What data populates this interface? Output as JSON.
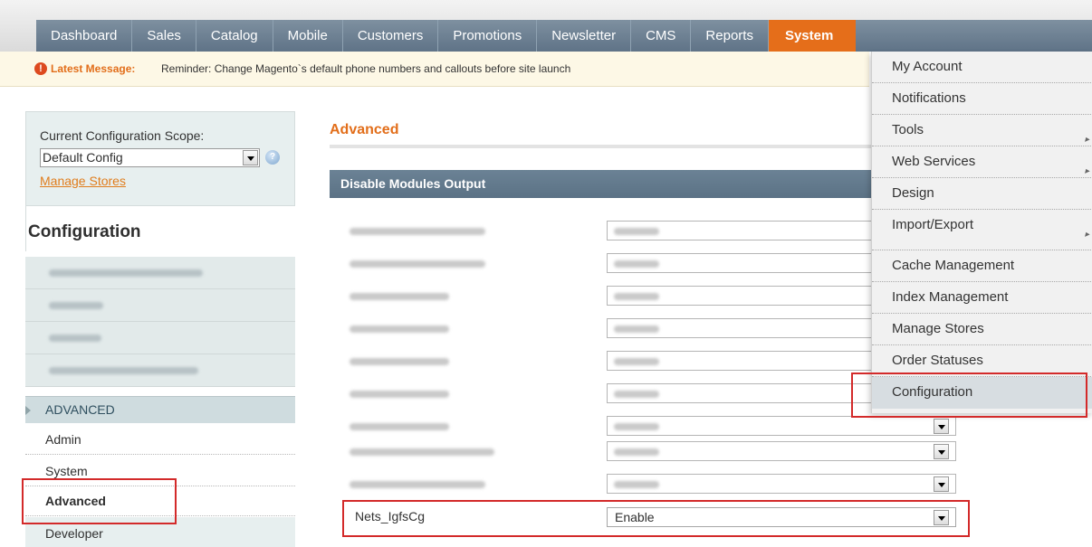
{
  "nav": {
    "items": [
      {
        "label": "Dashboard"
      },
      {
        "label": "Sales"
      },
      {
        "label": "Catalog"
      },
      {
        "label": "Mobile"
      },
      {
        "label": "Customers"
      },
      {
        "label": "Promotions"
      },
      {
        "label": "Newsletter"
      },
      {
        "label": "CMS"
      },
      {
        "label": "Reports"
      },
      {
        "label": "System"
      }
    ],
    "active": "System",
    "active_color": "#e56e1a"
  },
  "message": {
    "icon": "alert-icon",
    "label": "Latest Message:",
    "text": "Reminder: Change Magento`s default phone numbers and callouts before site launch"
  },
  "scope": {
    "label": "Current Configuration Scope:",
    "selected": "Default Config",
    "manage_link": "Manage Stores",
    "help_icon": "help-icon"
  },
  "sidebar": {
    "title": "Configuration",
    "section_label": "ADVANCED",
    "items": [
      {
        "label": "Admin"
      },
      {
        "label": "System"
      },
      {
        "label": "Advanced"
      },
      {
        "label": "Developer"
      }
    ],
    "active_item": "Advanced"
  },
  "main": {
    "title": "Advanced",
    "section_header": "Disable Modules Output",
    "highlight_row": {
      "module": "Nets_IgfsCg",
      "value": "Enable"
    }
  },
  "system_menu": {
    "items": [
      {
        "label": "My Account"
      },
      {
        "label": "Notifications"
      },
      {
        "label": "Tools"
      },
      {
        "label": "Web Services"
      },
      {
        "label": "Design"
      },
      {
        "label": "Import/Export"
      },
      {
        "label": "Cache Management"
      },
      {
        "label": "Index Management"
      },
      {
        "label": "Manage Stores"
      },
      {
        "label": "Order Statuses"
      },
      {
        "label": "Configuration"
      }
    ],
    "selected": "Configuration"
  },
  "colors": {
    "accent_orange": "#e26e1a",
    "highlight_red": "#d32a2a",
    "nav_blue": "#6b8295"
  }
}
